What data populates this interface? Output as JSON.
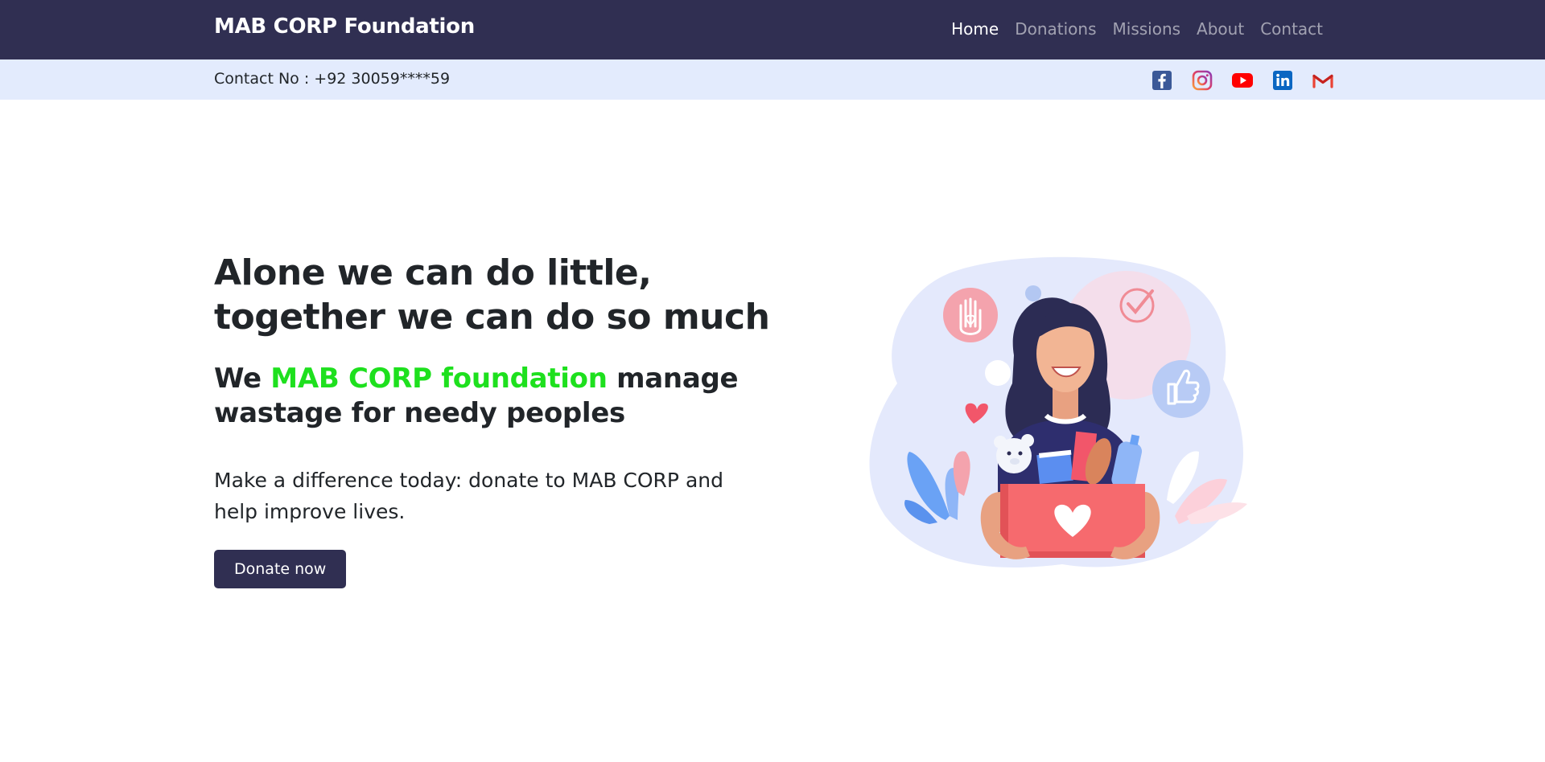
{
  "navbar": {
    "brand": "MAB CORP Foundation",
    "links": [
      {
        "label": "Home",
        "active": true
      },
      {
        "label": "Donations",
        "active": false
      },
      {
        "label": "Missions",
        "active": false
      },
      {
        "label": "About",
        "active": false
      },
      {
        "label": "Contact",
        "active": false
      }
    ]
  },
  "contact_bar": {
    "text": "Contact No : +92 30059****59",
    "socials": [
      "facebook-icon",
      "instagram-icon",
      "youtube-icon",
      "linkedin-icon",
      "gmail-icon"
    ]
  },
  "hero": {
    "headline_line1": "Alone we can do little,",
    "headline_line2": "together we can do so much",
    "subhead_prefix": "We ",
    "subhead_accent": "MAB CORP foundation",
    "subhead_suffix": " manage wastage for needy peoples",
    "lead": "Make a difference today: donate to MAB CORP and help improve lives.",
    "cta_label": "Donate now"
  },
  "colors": {
    "navbar_bg": "#302f52",
    "contact_bar_bg": "#e3ebfd",
    "accent_green": "#1ee01e",
    "button_bg": "#302f52"
  }
}
